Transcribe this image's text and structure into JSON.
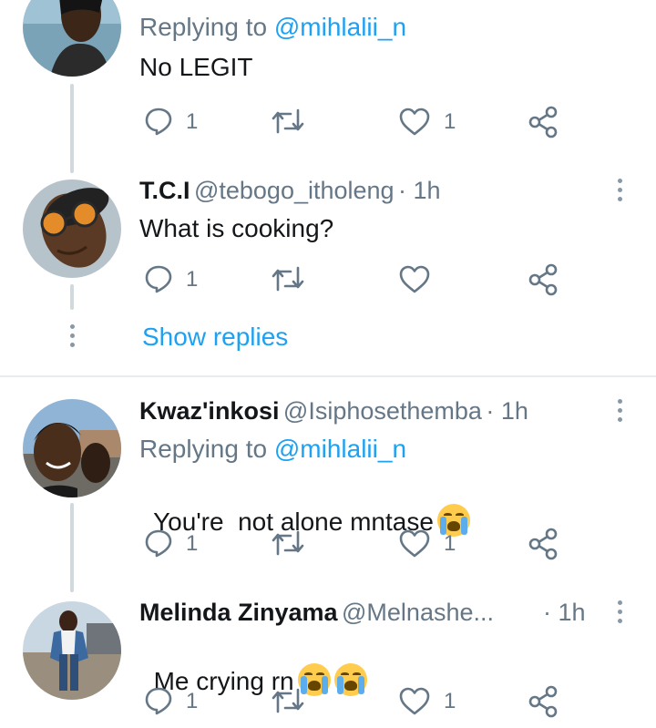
{
  "tweets": [
    {
      "replying_prefix": "Replying to ",
      "replying_to": "@mihlalii_n",
      "text": "No LEGIT",
      "reply_count": "1",
      "like_count": "1"
    },
    {
      "name": "T.C.I",
      "handle": "@tebogo_itholeng",
      "time": "· 1h",
      "text": "What is cooking?",
      "reply_count": "1",
      "show_replies": "Show replies"
    },
    {
      "name": "Kwaz'inkosi",
      "handle": "@Isiphosethemba",
      "time": "· 1h",
      "replying_prefix": "Replying to ",
      "replying_to": "@mihlalii_n",
      "text": "You're  not alone mntase",
      "reply_count": "1",
      "like_count": "1"
    },
    {
      "name": "Melinda Zinyama",
      "handle": "@Melnashe...",
      "time": "· 1h",
      "text": "Me crying rn",
      "reply_count": "1",
      "like_count": "1"
    }
  ],
  "icons": {
    "reply": "reply-icon",
    "retweet": "retweet-icon",
    "like": "heart-icon",
    "share": "share-icon",
    "more": "more-vertical-icon",
    "emoji": "loudly-crying-face-emoji"
  },
  "colors": {
    "link": "#1da1f2",
    "secondary_text": "#657786",
    "icon": "#657786",
    "thread_line": "#cfd9de"
  }
}
